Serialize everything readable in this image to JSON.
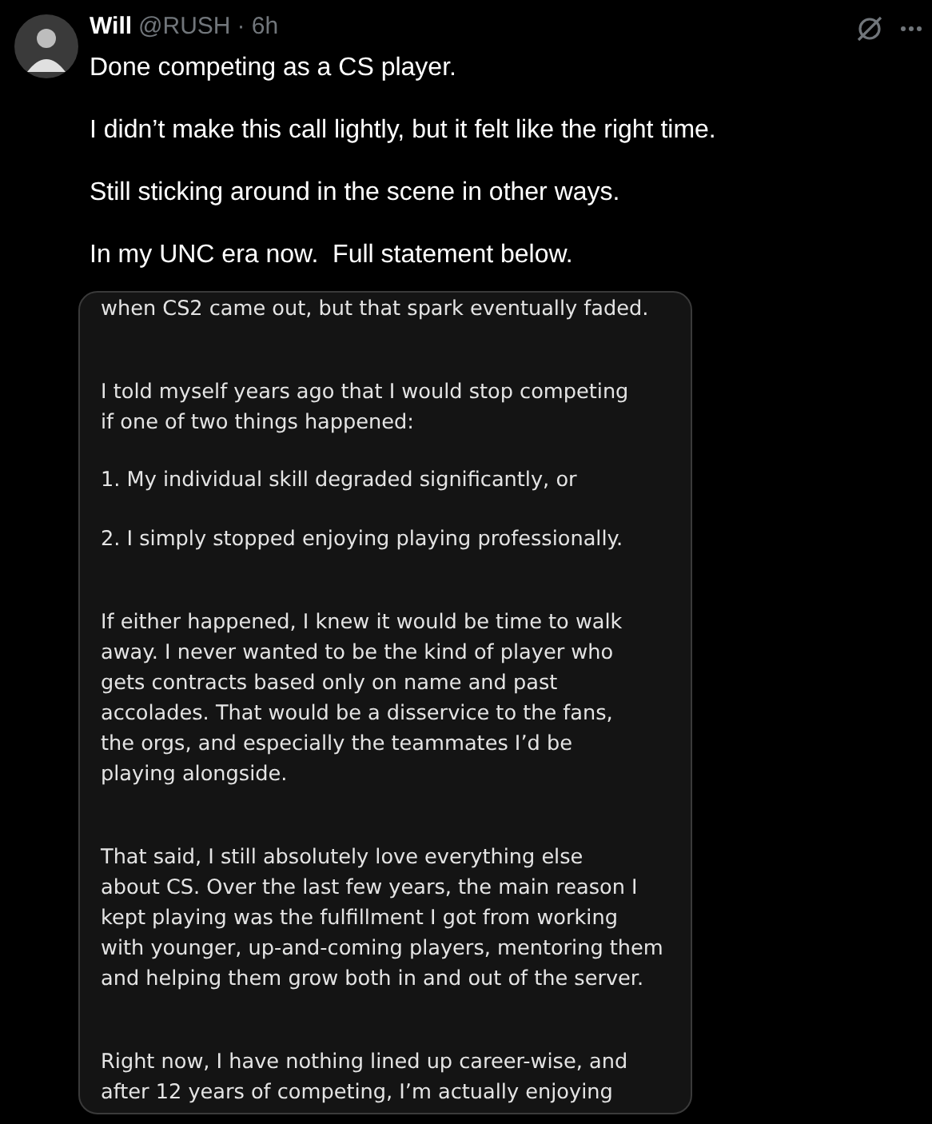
{
  "post": {
    "author": "Will",
    "handle": "@RUSH",
    "time": "· 6h",
    "paragraphs": [
      "Done competing as a CS player.",
      "I didn’t make this call lightly, but it felt like the right time.",
      "Still sticking around in the scene in other ways.",
      "In my UNC era now.  Full statement below."
    ],
    "image": {
      "kind": "document",
      "paragraphs": [
        [
          "when CS2 came out, but that spark eventually faded."
        ],
        [
          "I told myself years ago that I would stop competing",
          "if one of two things happened:"
        ],
        [
          "1. My individual skill degraded significantly, or"
        ],
        [
          "2. I simply stopped enjoying playing professionally."
        ],
        [
          "If either happened, I knew it would be time to walk",
          "away. I never wanted to be the kind of player who",
          "gets contracts based only on name and past",
          "accolades. That would be a disservice to the fans,",
          "the orgs, and especially the teammates I’d be",
          "playing alongside."
        ],
        [
          "That said, I still absolutely love everything else",
          "about CS. Over the last few years, the main reason I",
          "kept playing was the fulfillment I got from working",
          "with younger, up-and-coming players, mentoring them",
          "and helping them grow both in and out of the server."
        ],
        [
          "Right now, I have nothing lined up career-wise, and",
          "after 12 years of competing, I’m actually enjoying"
        ]
      ]
    }
  }
}
